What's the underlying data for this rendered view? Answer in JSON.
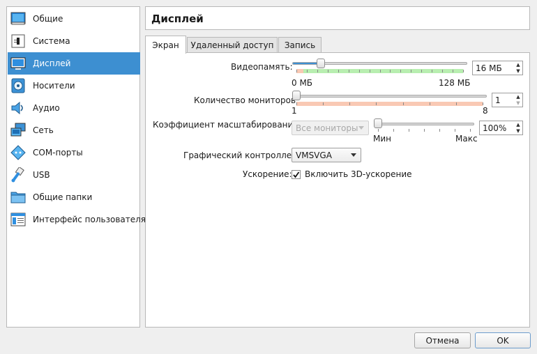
{
  "sidebar": {
    "items": [
      {
        "label": "Общие",
        "icon": "general-icon"
      },
      {
        "label": "Система",
        "icon": "system-icon"
      },
      {
        "label": "Дисплей",
        "icon": "display-icon",
        "selected": true
      },
      {
        "label": "Носители",
        "icon": "storage-icon"
      },
      {
        "label": "Аудио",
        "icon": "audio-icon"
      },
      {
        "label": "Сеть",
        "icon": "network-icon"
      },
      {
        "label": "COM-порты",
        "icon": "serial-ports-icon"
      },
      {
        "label": "USB",
        "icon": "usb-icon"
      },
      {
        "label": "Общие папки",
        "icon": "shared-folders-icon"
      },
      {
        "label": "Интерфейс пользователя",
        "icon": "user-interface-icon"
      }
    ]
  },
  "page_title": "Дисплей",
  "tabs": [
    {
      "label": "Экран",
      "active": true
    },
    {
      "label": "Удаленный доступ",
      "active": false
    },
    {
      "label": "Запись",
      "active": false
    }
  ],
  "screen": {
    "video_memory": {
      "label": "Видеопамять:",
      "value": "16 МБ",
      "min_label": "0 МБ",
      "max_label": "128 МБ",
      "fraction": 0.125
    },
    "monitors": {
      "label": "Количество мониторов:",
      "value": "1",
      "min_label": "1",
      "max_label": "8",
      "fraction": 0.0
    },
    "scale": {
      "label": "Коэффициент масштабирования:",
      "monitor_select": "Все мониторы",
      "value": "100%",
      "min_label": "Мин",
      "max_label": "Макс",
      "fraction": 0.0
    },
    "graphics_controller": {
      "label": "Графический контроллер:",
      "value": "VMSVGA"
    },
    "acceleration": {
      "label": "Ускорение:",
      "checkbox_label": "Включить 3D-ускорение",
      "checked": true
    }
  },
  "buttons": {
    "cancel": "Отмена",
    "ok": "OK"
  },
  "colors": {
    "accent": "#3d8fd1",
    "good_range": "#b8eeb0",
    "bad_range": "#f9c9b4"
  }
}
